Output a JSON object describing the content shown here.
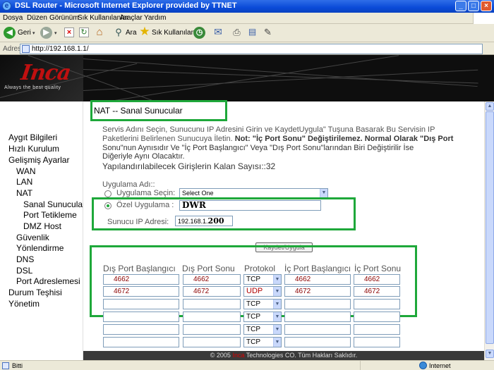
{
  "window": {
    "title": "DSL Router - Microsoft Internet Explorer provided by TTNET"
  },
  "menu": [
    "Dosya",
    "Düzen",
    "Görünüm",
    "Sık Kullanılanlar",
    "Araçlar",
    "Yardım"
  ],
  "toolbar": {
    "back_label": "Geri",
    "search_label": "Ara",
    "favorites_label": "Sık Kullanılanlar"
  },
  "address": {
    "label": "Adres",
    "url": "http://192.168.1.1/"
  },
  "brand": {
    "logo": "Inca",
    "tagline": "Always the best quality"
  },
  "nav": [
    {
      "label": "Aygıt Bilgileri"
    },
    {
      "label": "Hızlı Kurulum"
    },
    {
      "label": "Gelişmiş Ayarlar"
    },
    {
      "label": "WAN"
    },
    {
      "label": "LAN"
    },
    {
      "label": "NAT"
    },
    {
      "label": "Sanal Sunucular"
    },
    {
      "label": "Port Tetikleme"
    },
    {
      "label": "DMZ Host"
    },
    {
      "label": "Güvenlik"
    },
    {
      "label": "Yönlendirme"
    },
    {
      "label": "DNS"
    },
    {
      "label": "DSL"
    },
    {
      "label": "Port Adreslemesi"
    },
    {
      "label": "Durum Teşhisi"
    },
    {
      "label": "Yönetim"
    }
  ],
  "page": {
    "title": "NAT -- Sanal Sunucular",
    "intro_line1": "Servis Adını Seçin, Sunucunu IP Adresini Girin ve  KaydetUygula\" Tuşuna Basarak Bu Servisin IP",
    "intro_line2_pre": "Paketlerini Belirlenen Sunucuya İletin. ",
    "intro_note": "Not: \"İç Port Sonu\" Değiştirilemez. Normal Olarak \"Dış Port",
    "intro_line3": "Sonu\"nun Aynısıdır Ve  \"İç Port Başlangıcı\" Veya \"Dış Port Sonu\"larından Biri Değiştirilir İse",
    "intro_line4": "Diğeriyle Aynı Olacaktır.",
    "remaining": "Yapılandırılabilecek Girişlerin Kalan Sayısı::32",
    "app_name_label": "Uygulama Adı::",
    "select_app_label": "Uygulama Seçin:",
    "select_app_value": "Select One",
    "custom_app_label": "Özel Uygulama :",
    "custom_app_value": "DWR",
    "server_ip_label": "Sunucu IP Adresi:",
    "server_ip_prefix": "192.168.1.",
    "server_ip_suffix": "200",
    "save_button": "Kaydet/Uygula"
  },
  "table": {
    "headers": [
      "Dış Port Başlangıcı",
      "Dış Port Sonu",
      "Protokol",
      "İç Port Başlangıcı",
      "İç Port Sonu"
    ],
    "rows": [
      {
        "ext_start": "4662",
        "ext_end": "4662",
        "protocol": "TCP",
        "int_start": "4662",
        "int_end": "4662"
      },
      {
        "ext_start": "4672",
        "ext_end": "4672",
        "protocol": "UDP",
        "int_start": "4672",
        "int_end": "4672"
      },
      {
        "ext_start": "",
        "ext_end": "",
        "protocol": "TCP",
        "int_start": "",
        "int_end": ""
      },
      {
        "ext_start": "",
        "ext_end": "",
        "protocol": "TCP",
        "int_start": "",
        "int_end": ""
      },
      {
        "ext_start": "",
        "ext_end": "",
        "protocol": "TCP",
        "int_start": "",
        "int_end": ""
      },
      {
        "ext_start": "",
        "ext_end": "",
        "protocol": "TCP",
        "int_start": "",
        "int_end": ""
      }
    ]
  },
  "footer": {
    "pre": "© 2005 ",
    "brand": "Inca",
    "post": " Technologies CO. Tüm Hakları Saklıdır."
  },
  "status": {
    "left": "Bitti",
    "right": "Internet"
  },
  "colors": {
    "highlight": "#1ea83a",
    "brand_red": "#c01010",
    "titlebar": "#0a4ad8"
  }
}
